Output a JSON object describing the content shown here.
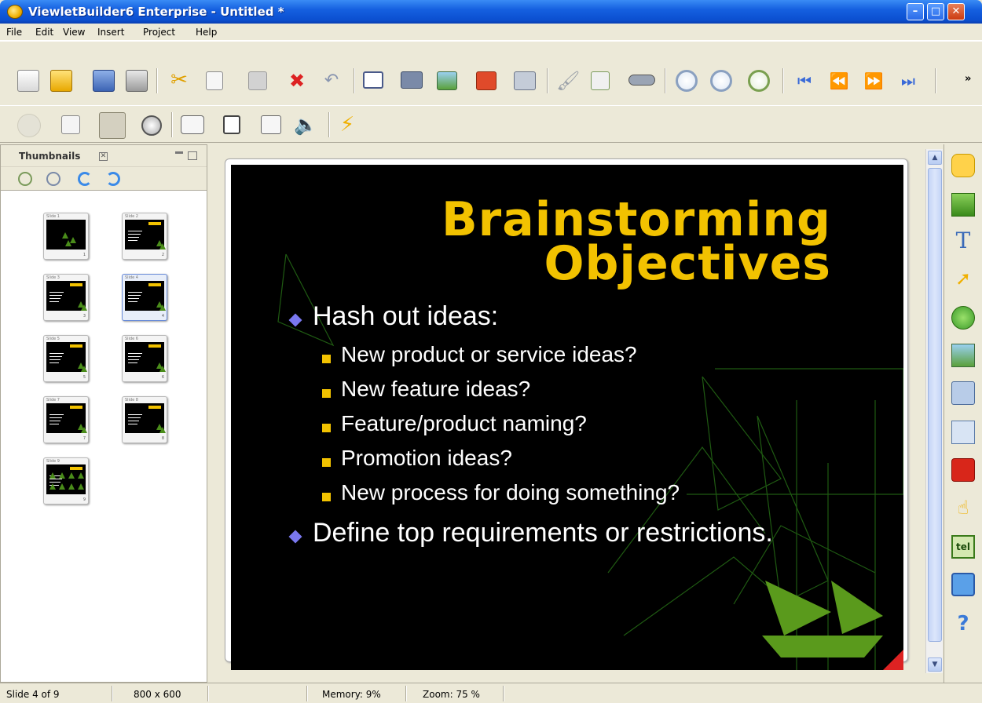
{
  "window": {
    "title": "ViewletBuilder6 Enterprise - Untitled *",
    "minimize_glyph": "–",
    "maximize_glyph": "□",
    "close_glyph": "✕"
  },
  "menu": [
    "File",
    "Edit",
    "View",
    "Insert",
    "Project",
    "Help"
  ],
  "toolbar": {
    "overflow_glyph": "»",
    "row1_icons": [
      "new-file-icon",
      "open-folder-icon",
      "save-icon",
      "print-icon",
      "cut-icon",
      "copy-icon",
      "paste-icon",
      "delete-icon",
      "undo-icon",
      "add-slide-icon",
      "capture-icon",
      "add-image-slide-icon",
      "add-ppt-slide-icon",
      "add-quiz-slide-icon",
      "brush-icon",
      "properties-icon",
      "find-icon",
      "zoom-in-icon",
      "zoom-out-icon",
      "zoom-fit-icon",
      "first-slide-icon",
      "previous-slide-icon",
      "next-slide-icon",
      "last-slide-icon"
    ],
    "row2_icons": [
      "logo-watermark-icon",
      "slide-list-icon",
      "preview-eye-icon",
      "cursor-hide-icon",
      "callout-icon",
      "blank-slide-icon",
      "slide-properties-icon",
      "audio-icon",
      "publish-lightning-icon"
    ]
  },
  "thumbnails_panel": {
    "title": "Thumbnails",
    "close_glyph": "✕",
    "tools": [
      "zoom-in-icon",
      "zoom-out-icon",
      "rotate-left-icon",
      "rotate-right-icon"
    ],
    "slides": [
      {
        "label": "Slide 1",
        "number": "1",
        "selected": false
      },
      {
        "label": "Slide 2",
        "number": "2",
        "selected": false
      },
      {
        "label": "Slide 3",
        "number": "3",
        "selected": false
      },
      {
        "label": "Slide 4",
        "number": "4",
        "selected": true
      },
      {
        "label": "Slide 5",
        "number": "5",
        "selected": false
      },
      {
        "label": "Slide 6",
        "number": "6",
        "selected": false
      },
      {
        "label": "Slide 7",
        "number": "7",
        "selected": false
      },
      {
        "label": "Slide 8",
        "number": "8",
        "selected": false
      },
      {
        "label": "Slide 9",
        "number": "9",
        "selected": false
      }
    ]
  },
  "slide": {
    "title_line1": "Brainstorming",
    "title_line2": "Objectives",
    "bullets": [
      {
        "level": 1,
        "text": "Hash out ideas:"
      },
      {
        "level": 2,
        "text": "New product or service ideas?"
      },
      {
        "level": 2,
        "text": "New feature ideas?"
      },
      {
        "level": 2,
        "text": "Feature/product naming?"
      },
      {
        "level": 2,
        "text": "Promotion ideas?"
      },
      {
        "level": 2,
        "text": "New process for doing something?"
      },
      {
        "level": 1,
        "text": "Define top requirements or restrictions."
      }
    ],
    "colors": {
      "title": "#f2c200",
      "background": "#000000",
      "level1_marker": "#7a78f0",
      "level2_marker": "#f2c200",
      "leaf": "#5a9a1c"
    }
  },
  "right_toolbox": [
    "callout-icon",
    "image-icon",
    "text-icon",
    "pointer-icon",
    "shape-icon",
    "picture-icon",
    "button-icon",
    "movie-icon",
    "pause-icon",
    "click-icon",
    "tel-icon",
    "email-icon",
    "help-icon"
  ],
  "status": {
    "slide": "Slide 4 of 9",
    "size": "800 x 600",
    "memory": "Memory: 9%",
    "zoom": "Zoom: 75 %"
  }
}
